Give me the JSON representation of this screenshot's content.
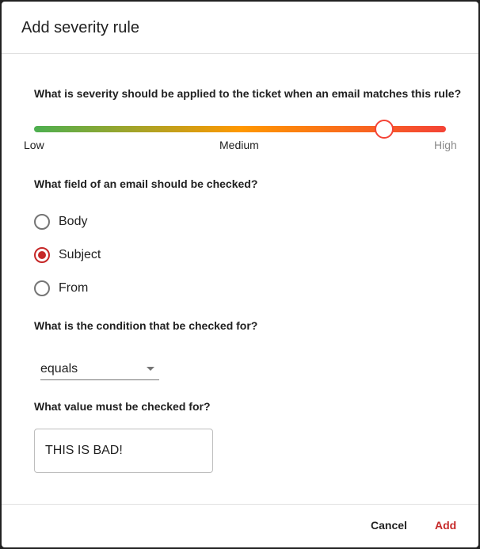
{
  "dialog": {
    "title": "Add severity rule"
  },
  "severity": {
    "question": "What is severity should be applied to the ticket when an email matches this rule?",
    "labels": [
      "Low",
      "Medium",
      "High"
    ],
    "value_fraction": 0.85,
    "colors": {
      "low": "#4caf50",
      "medium": "#ff9800",
      "high": "#f44336"
    }
  },
  "field": {
    "question": "What field of an email should be checked?",
    "options": [
      {
        "label": "Body",
        "checked": false
      },
      {
        "label": "Subject",
        "checked": true
      },
      {
        "label": "From",
        "checked": false
      }
    ]
  },
  "condition": {
    "question": "What is the condition that be checked for?",
    "selected": "equals"
  },
  "value": {
    "question": "What value must be checked for?",
    "input_value": "THIS IS BAD!"
  },
  "actions": {
    "cancel": "Cancel",
    "add": "Add",
    "accent": "#c62828"
  }
}
